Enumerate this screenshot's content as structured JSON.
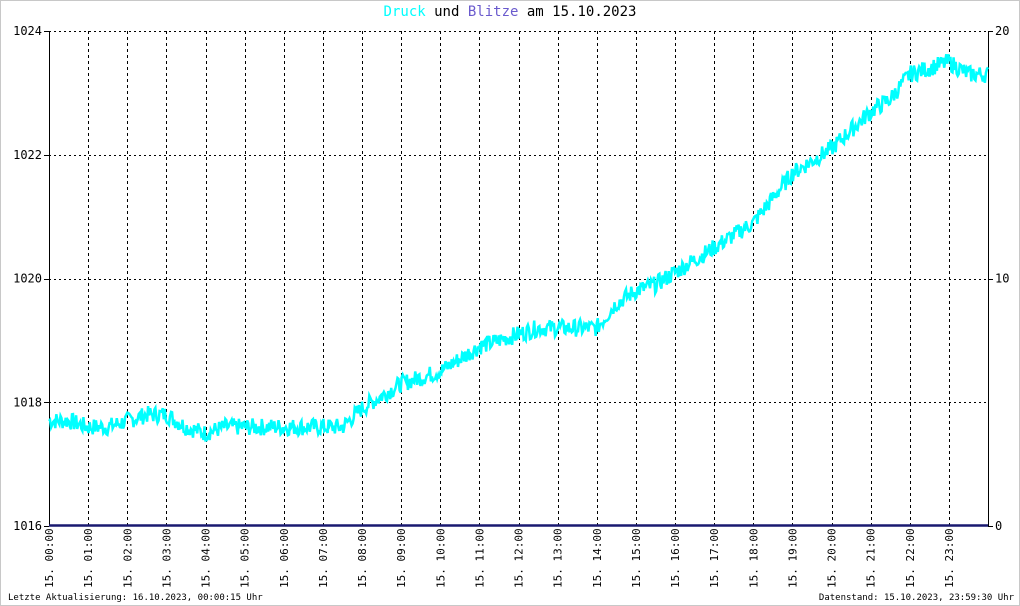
{
  "title": {
    "series1": "Druck",
    "joiner": "und",
    "series2": "Blitze",
    "date_prefix": "am",
    "date": "15.10.2023"
  },
  "footer": {
    "left": "Letzte Aktualisierung: 16.10.2023, 00:00:15 Uhr",
    "right": "Datenstand: 15.10.2023, 23:59:30 Uhr"
  },
  "colors": {
    "druck": "#00ffff",
    "blitze": "#191970",
    "title_blitze": "#6a5acd",
    "grid": "#000000"
  },
  "chart_data": {
    "type": "line",
    "title": "Druck und Blitze am 15.10.2023",
    "grid": true,
    "x_ticks": [
      "15. 00:00",
      "15. 01:00",
      "15. 02:00",
      "15. 03:00",
      "15. 04:00",
      "15. 05:00",
      "15. 06:00",
      "15. 07:00",
      "15. 08:00",
      "15. 09:00",
      "15. 10:00",
      "15. 11:00",
      "15. 12:00",
      "15. 13:00",
      "15. 14:00",
      "15. 15:00",
      "15. 16:00",
      "15. 17:00",
      "15. 18:00",
      "15. 19:00",
      "15. 20:00",
      "15. 21:00",
      "15. 22:00",
      "15. 23:00"
    ],
    "y_left": {
      "ylim": [
        1016,
        1024
      ],
      "ticks": [
        1016,
        1018,
        1020,
        1022,
        1024
      ]
    },
    "y_right": {
      "ylim": [
        0,
        20
      ],
      "ticks": [
        0,
        10,
        20
      ]
    },
    "series": [
      {
        "name": "Druck",
        "axis": "left",
        "x_hours": [
          0,
          0.5,
          1,
          1.5,
          2,
          2.5,
          3,
          3.5,
          4,
          4.5,
          5,
          5.5,
          6,
          6.5,
          7,
          7.5,
          8,
          8.5,
          9,
          9.5,
          10,
          10.5,
          11,
          11.5,
          12,
          12.5,
          13,
          13.5,
          14,
          14.5,
          15,
          15.5,
          16,
          16.5,
          17,
          17.5,
          18,
          18.5,
          19,
          19.5,
          20,
          20.5,
          21,
          21.5,
          22,
          22.5,
          23,
          23.5,
          24
        ],
        "values": [
          1017.7,
          1017.7,
          1017.6,
          1017.6,
          1017.7,
          1017.8,
          1017.8,
          1017.6,
          1017.5,
          1017.6,
          1017.6,
          1017.6,
          1017.6,
          1017.6,
          1017.6,
          1017.6,
          1017.9,
          1018.1,
          1018.3,
          1018.4,
          1018.5,
          1018.7,
          1018.9,
          1019.0,
          1019.1,
          1019.2,
          1019.2,
          1019.2,
          1019.2,
          1019.6,
          1019.8,
          1019.9,
          1020.1,
          1020.3,
          1020.5,
          1020.7,
          1020.9,
          1021.3,
          1021.7,
          1021.9,
          1022.1,
          1022.4,
          1022.7,
          1022.9,
          1023.3,
          1023.4,
          1023.5,
          1023.3,
          1023.3
        ]
      },
      {
        "name": "Blitze",
        "axis": "right",
        "x_hours": [
          0,
          24
        ],
        "values": [
          0,
          0
        ]
      }
    ]
  }
}
